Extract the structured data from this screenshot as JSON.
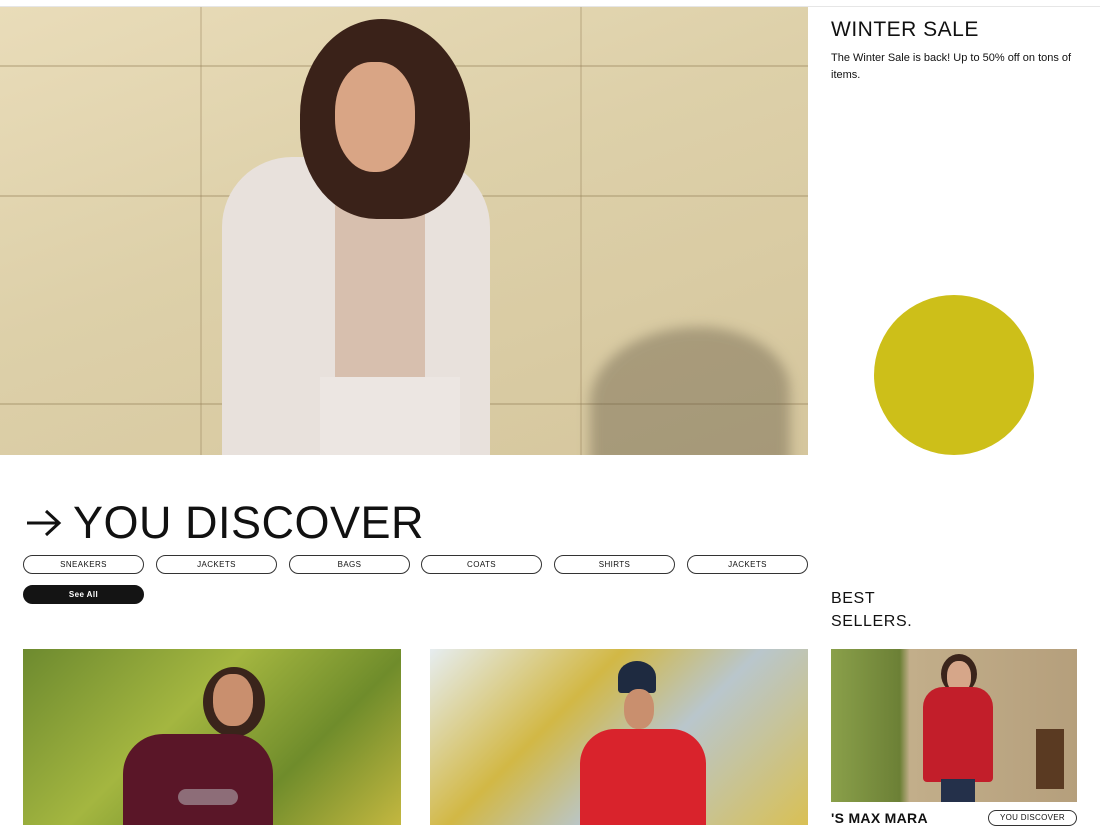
{
  "promo": {
    "title": "WINTER SALE",
    "text": "The Winter Sale is back! Up to 50% off on tons of items.",
    "accent_color": "#cdbf19"
  },
  "discover": {
    "arrow_icon": "arrow-right-icon",
    "heading": "YOU DISCOVER",
    "categories": [
      "SNEAKERS",
      "JACKETS",
      "BAGS",
      "COATS",
      "SHIRTS",
      "JACKETS"
    ],
    "see_all_label": "See All"
  },
  "best_sellers": {
    "title_line1": "BEST",
    "title_line2": "SELLERS.",
    "product_name": "'S MAX MARA",
    "product_tag": "YOU DISCOVER"
  }
}
